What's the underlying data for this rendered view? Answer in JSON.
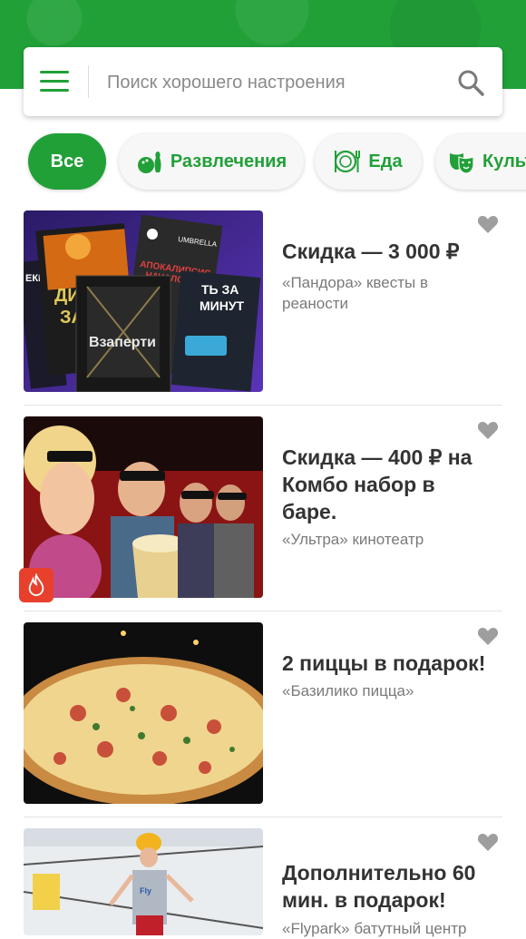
{
  "search": {
    "placeholder": "Поиск хорошего настроения"
  },
  "categories": [
    {
      "label": "Все",
      "active": true
    },
    {
      "label": "Развлечения",
      "icon": "bowling-icon"
    },
    {
      "label": "Еда",
      "icon": "plate-cutlery-icon"
    },
    {
      "label": "Культура",
      "icon": "theater-masks-icon"
    }
  ],
  "thumb_posters": {
    "poster_main": "Взаперти",
    "poster_umbrella": "UMBRELLA",
    "poster_apocalypse_a": "АПОКАЛИПСИС",
    "poster_apocalypse_b": "НАЧАЛО",
    "poster_minutes_a": "ТЬ ЗА",
    "poster_minutes_b": "МИНУТ",
    "poster_left": "ЕКЦИЮ",
    "poster_di": "ДИ",
    "poster_z": "ЗА"
  },
  "offers": [
    {
      "title": "Скидка — 3 000 ₽",
      "subtitle": "«Пандора» квесты в реаности"
    },
    {
      "title": "Скидка — 400 ₽ на Комбо набор в баре.",
      "subtitle": "«Ультра» кинотеатр",
      "badge": "fire-icon"
    },
    {
      "title": "2 пиццы в подарок!",
      "subtitle": "«Базилико пицца»"
    },
    {
      "title": "Дополнительно 60 мин. в подарок!",
      "subtitle": "«Flypark» батутный центр"
    }
  ],
  "colors": {
    "brand_green": "#21a038",
    "heart_grey": "#9e9e9e",
    "badge_red": "#e8402d"
  }
}
